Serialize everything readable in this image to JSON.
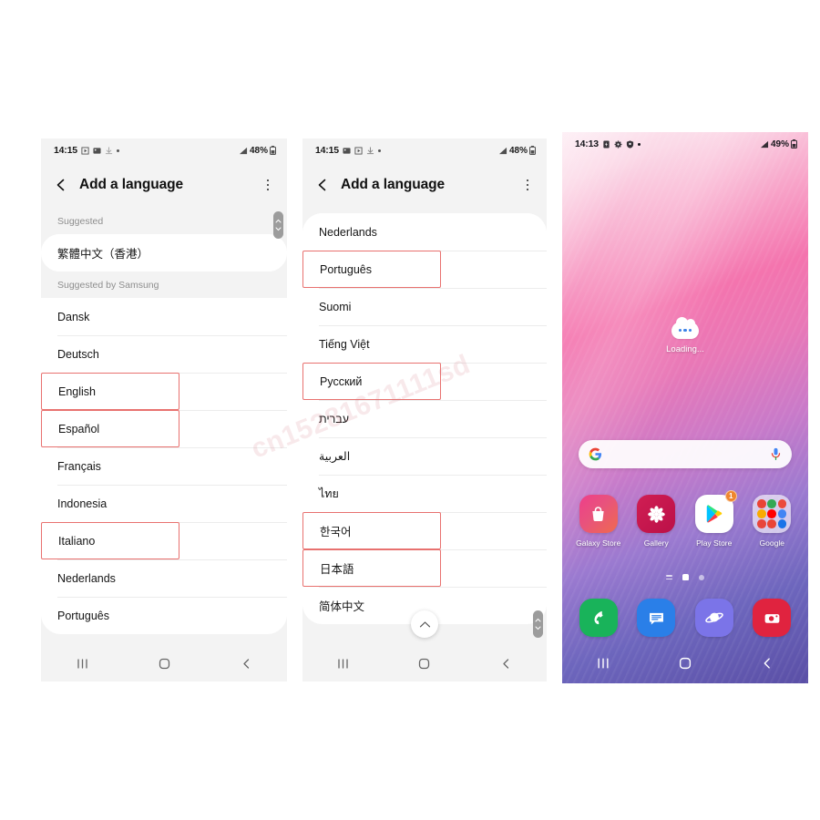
{
  "watermark": "cn15281671111sd",
  "panel1": {
    "status_bar": {
      "time": "14:15",
      "battery": "48%",
      "icons": [
        "play-icon",
        "image-icon",
        "download-icon",
        "dot-icon"
      ]
    },
    "appbar": {
      "title": "Add a language",
      "back_icon": "back-arrow-icon",
      "menu_icon": "overflow-menu-icon"
    },
    "sections": [
      {
        "header": "Suggested",
        "items": [
          {
            "label": "繁體中文（香港）",
            "highlighted": false,
            "rtl": false
          }
        ]
      },
      {
        "header": "Suggested by Samsung",
        "items": [
          {
            "label": "Dansk",
            "highlighted": false,
            "rtl": false
          },
          {
            "label": "Deutsch",
            "highlighted": false,
            "rtl": false
          },
          {
            "label": "English",
            "highlighted": true,
            "rtl": false
          },
          {
            "label": "Español",
            "highlighted": true,
            "rtl": false
          },
          {
            "label": "Français",
            "highlighted": false,
            "rtl": false
          },
          {
            "label": "Indonesia",
            "highlighted": false,
            "rtl": false
          },
          {
            "label": "Italiano",
            "highlighted": true,
            "rtl": false
          },
          {
            "label": "Nederlands",
            "highlighted": false,
            "rtl": false
          },
          {
            "label": "Português",
            "highlighted": false,
            "rtl": false
          }
        ]
      }
    ],
    "nav_bar": {
      "recents": "recents-icon",
      "home": "home-icon",
      "back": "back-icon"
    }
  },
  "panel2": {
    "status_bar": {
      "time": "14:15",
      "battery": "48%",
      "icons": [
        "image-icon",
        "play-icon",
        "download-icon",
        "dot-icon"
      ]
    },
    "appbar": {
      "title": "Add a language",
      "back_icon": "back-arrow-icon",
      "menu_icon": "overflow-menu-icon"
    },
    "items": [
      {
        "label": "Nederlands",
        "highlighted": false,
        "rtl": false
      },
      {
        "label": "Português",
        "highlighted": true,
        "rtl": false
      },
      {
        "label": "Suomi",
        "highlighted": false,
        "rtl": false
      },
      {
        "label": "Tiếng Việt",
        "highlighted": false,
        "rtl": false
      },
      {
        "label": "Русский",
        "highlighted": true,
        "rtl": false
      },
      {
        "label": "עברית",
        "highlighted": false,
        "rtl": true
      },
      {
        "label": "العربية",
        "highlighted": false,
        "rtl": true
      },
      {
        "label": "ไทย",
        "highlighted": false,
        "rtl": false
      },
      {
        "label": "한국어",
        "highlighted": true,
        "rtl": false
      },
      {
        "label": "日本語",
        "highlighted": true,
        "rtl": false
      },
      {
        "label": "简体中文",
        "highlighted": false,
        "rtl": false
      }
    ],
    "scroll_to_top": "scroll-to-top-icon",
    "nav_bar": {
      "recents": "recents-icon",
      "home": "home-icon",
      "back": "back-icon"
    }
  },
  "panel3": {
    "status_bar": {
      "time": "14:13",
      "battery": "49%",
      "icons": [
        "battery-saver-icon",
        "settings-icon",
        "security-icon",
        "dot-icon"
      ]
    },
    "loading_widget": {
      "label": "Loading...",
      "icon": "cloud-bubble-icon"
    },
    "search_bar": {
      "logo_icon": "google-g-icon",
      "mic_icon": "microphone-icon"
    },
    "apps": [
      {
        "label": "Galaxy Store",
        "icon": "galaxy-store-icon",
        "badge": null
      },
      {
        "label": "Gallery",
        "icon": "gallery-icon",
        "badge": null
      },
      {
        "label": "Play Store",
        "icon": "play-store-icon",
        "badge": "1"
      },
      {
        "label": "Google",
        "icon": "google-folder-icon",
        "badge": null
      }
    ],
    "page_indicators": [
      "app-list-indicator",
      "home-page-indicator",
      "page-dot-indicator"
    ],
    "dock": [
      {
        "label": "Phone",
        "icon": "phone-icon",
        "color": "#19b35a"
      },
      {
        "label": "Messages",
        "icon": "messages-icon",
        "color": "#2a7fe8"
      },
      {
        "label": "Internet",
        "icon": "internet-icon",
        "color": "#7b74e8"
      },
      {
        "label": "Camera",
        "icon": "camera-icon",
        "color": "#e0233f"
      }
    ],
    "nav_bar": {
      "recents": "recents-icon",
      "home": "home-icon",
      "back": "back-icon"
    }
  }
}
